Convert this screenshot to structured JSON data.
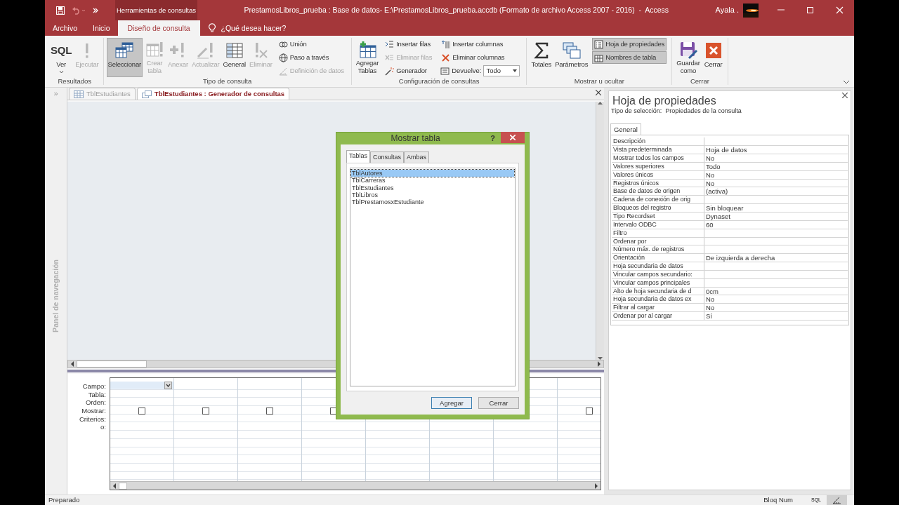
{
  "title_bar": {
    "contextual_tab": "Herramientas de consultas",
    "title": "PrestamosLibros_prueba : Base de datos- E:\\PrestamosLibros_prueba.accdb (Formato de archivo Access 2007 - 2016)  -  Access",
    "user": "Ayala ."
  },
  "ribbon_tabs": [
    {
      "label": "Archivo",
      "selected": false
    },
    {
      "label": "Inicio",
      "selected": false
    },
    {
      "label": "Diseño de consulta",
      "selected": true
    }
  ],
  "tell_me": "¿Qué desea hacer?",
  "ribbon_groups": [
    {
      "label": "Resultados",
      "items": [
        {
          "kind": "large",
          "label": "Ver",
          "icon_text": "SQL",
          "dropdown": true,
          "disabled": false,
          "pressed": false
        },
        {
          "kind": "large",
          "label": "Ejecutar",
          "dropdown": false,
          "disabled": true,
          "pressed": false
        }
      ]
    },
    {
      "label": "Tipo de consulta",
      "items": [
        {
          "kind": "large",
          "label": "Seleccionar",
          "dropdown": false,
          "disabled": false,
          "pressed": true
        },
        {
          "kind": "large",
          "label": "Crear\ntabla",
          "dropdown": false,
          "disabled": true,
          "pressed": false
        },
        {
          "kind": "large",
          "label": "Anexar",
          "dropdown": false,
          "disabled": true,
          "pressed": false
        },
        {
          "kind": "large",
          "label": "Actualizar",
          "dropdown": false,
          "disabled": true,
          "pressed": false
        },
        {
          "kind": "large",
          "label": "General",
          "dropdown": false,
          "disabled": false,
          "pressed": false
        },
        {
          "kind": "large",
          "label": "Eliminar",
          "dropdown": false,
          "disabled": true,
          "pressed": false
        },
        {
          "kind": "column",
          "items": [
            {
              "kind": "button",
              "label": "Unión",
              "disabled": false,
              "pressed": false
            },
            {
              "kind": "button",
              "label": "Paso a través",
              "disabled": false,
              "pressed": false
            },
            {
              "kind": "button",
              "label": "Definición de datos",
              "disabled": true,
              "pressed": false
            }
          ]
        }
      ]
    },
    {
      "label": "Configuración de consultas",
      "items": [
        {
          "kind": "large",
          "label": "Agregar\nTablas",
          "dropdown": false,
          "disabled": false,
          "pressed": false
        },
        {
          "kind": "column",
          "items": [
            {
              "kind": "button",
              "label": "Insertar filas",
              "disabled": false,
              "pressed": false
            },
            {
              "kind": "button",
              "label": "Eliminar filas",
              "disabled": true,
              "pressed": false
            },
            {
              "kind": "button",
              "label": "Generador",
              "disabled": false,
              "pressed": false
            }
          ]
        },
        {
          "kind": "column",
          "items": [
            {
              "kind": "button",
              "label": "Insertar columnas",
              "disabled": false,
              "pressed": false
            },
            {
              "kind": "button",
              "label": "Eliminar columnas",
              "disabled": false,
              "pressed": false
            },
            {
              "kind": "combo",
              "label": "Devuelve:",
              "value": "Todo",
              "disabled": false,
              "pressed": false
            }
          ]
        }
      ]
    },
    {
      "label": "Mostrar u ocultar",
      "items": [
        {
          "kind": "large",
          "label": "Totales",
          "dropdown": false,
          "disabled": false,
          "pressed": false
        },
        {
          "kind": "large",
          "label": "Parámetros",
          "dropdown": false,
          "disabled": false,
          "pressed": false
        },
        {
          "kind": "column",
          "items": [
            {
              "kind": "button",
              "label": "Hoja de propiedades",
              "disabled": false,
              "pressed": true
            },
            {
              "kind": "button",
              "label": "Nombres de tabla",
              "disabled": false,
              "pressed": true
            }
          ]
        }
      ]
    },
    {
      "label": "Cerrar",
      "items": [
        {
          "kind": "large",
          "label": "Guardar\ncomo",
          "dropdown": false,
          "disabled": false,
          "pressed": false
        },
        {
          "kind": "large",
          "label": "Cerrar",
          "dropdown": false,
          "disabled": false,
          "pressed": false
        }
      ]
    }
  ],
  "nav_pane": {
    "toggle": "»",
    "label": "Panel de navegación"
  },
  "doc_tabs": [
    {
      "label": "TblEstudiantes",
      "selected": false
    },
    {
      "label": "TblEstudiantes : Generador de consultas",
      "selected": true
    }
  ],
  "design_grid": {
    "row_labels": [
      "Campo:",
      "Tabla:",
      "Orden:",
      "Mostrar:",
      "Criterios:",
      "o:"
    ],
    "columns": [
      {
        "active": true,
        "show": false
      },
      {
        "active": false,
        "show": false
      },
      {
        "active": false,
        "show": false
      },
      {
        "active": false,
        "show": false
      },
      {},
      {},
      {},
      {
        "active": false,
        "show": false
      }
    ]
  },
  "dialog": {
    "title": "Mostrar tabla",
    "help": "?",
    "tabs": [
      {
        "label": "Tablas",
        "selected": true
      },
      {
        "label": "Consultas",
        "selected": false
      },
      {
        "label": "Ambas",
        "selected": false
      }
    ],
    "items": [
      {
        "label": "TblAutores",
        "selected": true
      },
      {
        "label": "TblCarreras",
        "selected": false
      },
      {
        "label": "TblEstudiantes",
        "selected": false
      },
      {
        "label": "TblLibros",
        "selected": false
      },
      {
        "label": "TblPrestamosxEstudiante",
        "selected": false
      }
    ],
    "buttons": [
      {
        "label": "Agregar",
        "default": true
      },
      {
        "label": "Cerrar",
        "default": false
      }
    ]
  },
  "property_sheet": {
    "title": "Hoja de propiedades",
    "selection_type": "Tipo de selección:  Propiedades de la consulta",
    "tabs": [
      {
        "label": "General",
        "selected": true
      }
    ],
    "rows": [
      {
        "name": "Descripción"
      },
      {
        "name": "Vista predeterminada",
        "value": "Hoja de datos"
      },
      {
        "name": "Mostrar todos los campos",
        "value": "No"
      },
      {
        "name": "Valores superiores",
        "value": "Todo"
      },
      {
        "name": "Valores únicos",
        "value": "No"
      },
      {
        "name": "Registros únicos",
        "value": "No"
      },
      {
        "name": "Base de datos de origen",
        "value": "(activa)"
      },
      {
        "name": "Cadena de conexión de orig"
      },
      {
        "name": "Bloqueos del registro",
        "value": "Sin bloquear"
      },
      {
        "name": "Tipo Recordset",
        "value": "Dynaset"
      },
      {
        "name": "Intervalo ODBC",
        "value": "60"
      },
      {
        "name": "Filtro"
      },
      {
        "name": "Ordenar por"
      },
      {
        "name": "Número máx. de registros"
      },
      {
        "name": "Orientación",
        "value": "De izquierda a derecha"
      },
      {
        "name": "Hoja secundaria de datos"
      },
      {
        "name": "Vincular campos secundario:"
      },
      {
        "name": "Vincular campos principales"
      },
      {
        "name": "Alto de hoja secundaria de d",
        "value": "0cm"
      },
      {
        "name": "Hoja secundaria de datos ex",
        "value": "No"
      },
      {
        "name": "Filtrar al cargar",
        "value": "No"
      },
      {
        "name": "Ordenar por al cargar",
        "value": "Sí"
      }
    ]
  },
  "status_bar": {
    "text": "Preparado",
    "indicator": "Bloq Num",
    "views": [
      {
        "kind": "sql",
        "label": "SQL",
        "selected": false
      },
      {
        "kind": "design",
        "selected": true
      }
    ]
  }
}
